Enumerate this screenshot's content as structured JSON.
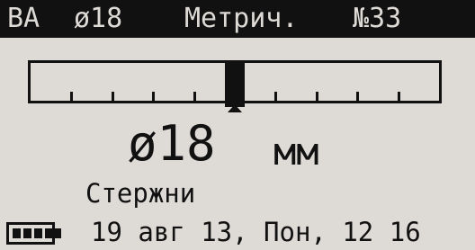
{
  "header": {
    "mode": "ВА",
    "diameter": "ø18",
    "units": "Метрич.",
    "unit_number": "№33"
  },
  "measurement": {
    "value": "ø18",
    "unit": "мм",
    "material": "Стержни"
  },
  "indicator": {
    "position_fraction": 0.5,
    "tick_count": 9
  },
  "status_bar": {
    "battery_icon": "battery-full-icon",
    "battery_level": 1.0,
    "datetime": "19 авг 13, Пон, 12 16"
  },
  "colors": {
    "screen": "#dedad6",
    "ink": "#111111"
  }
}
